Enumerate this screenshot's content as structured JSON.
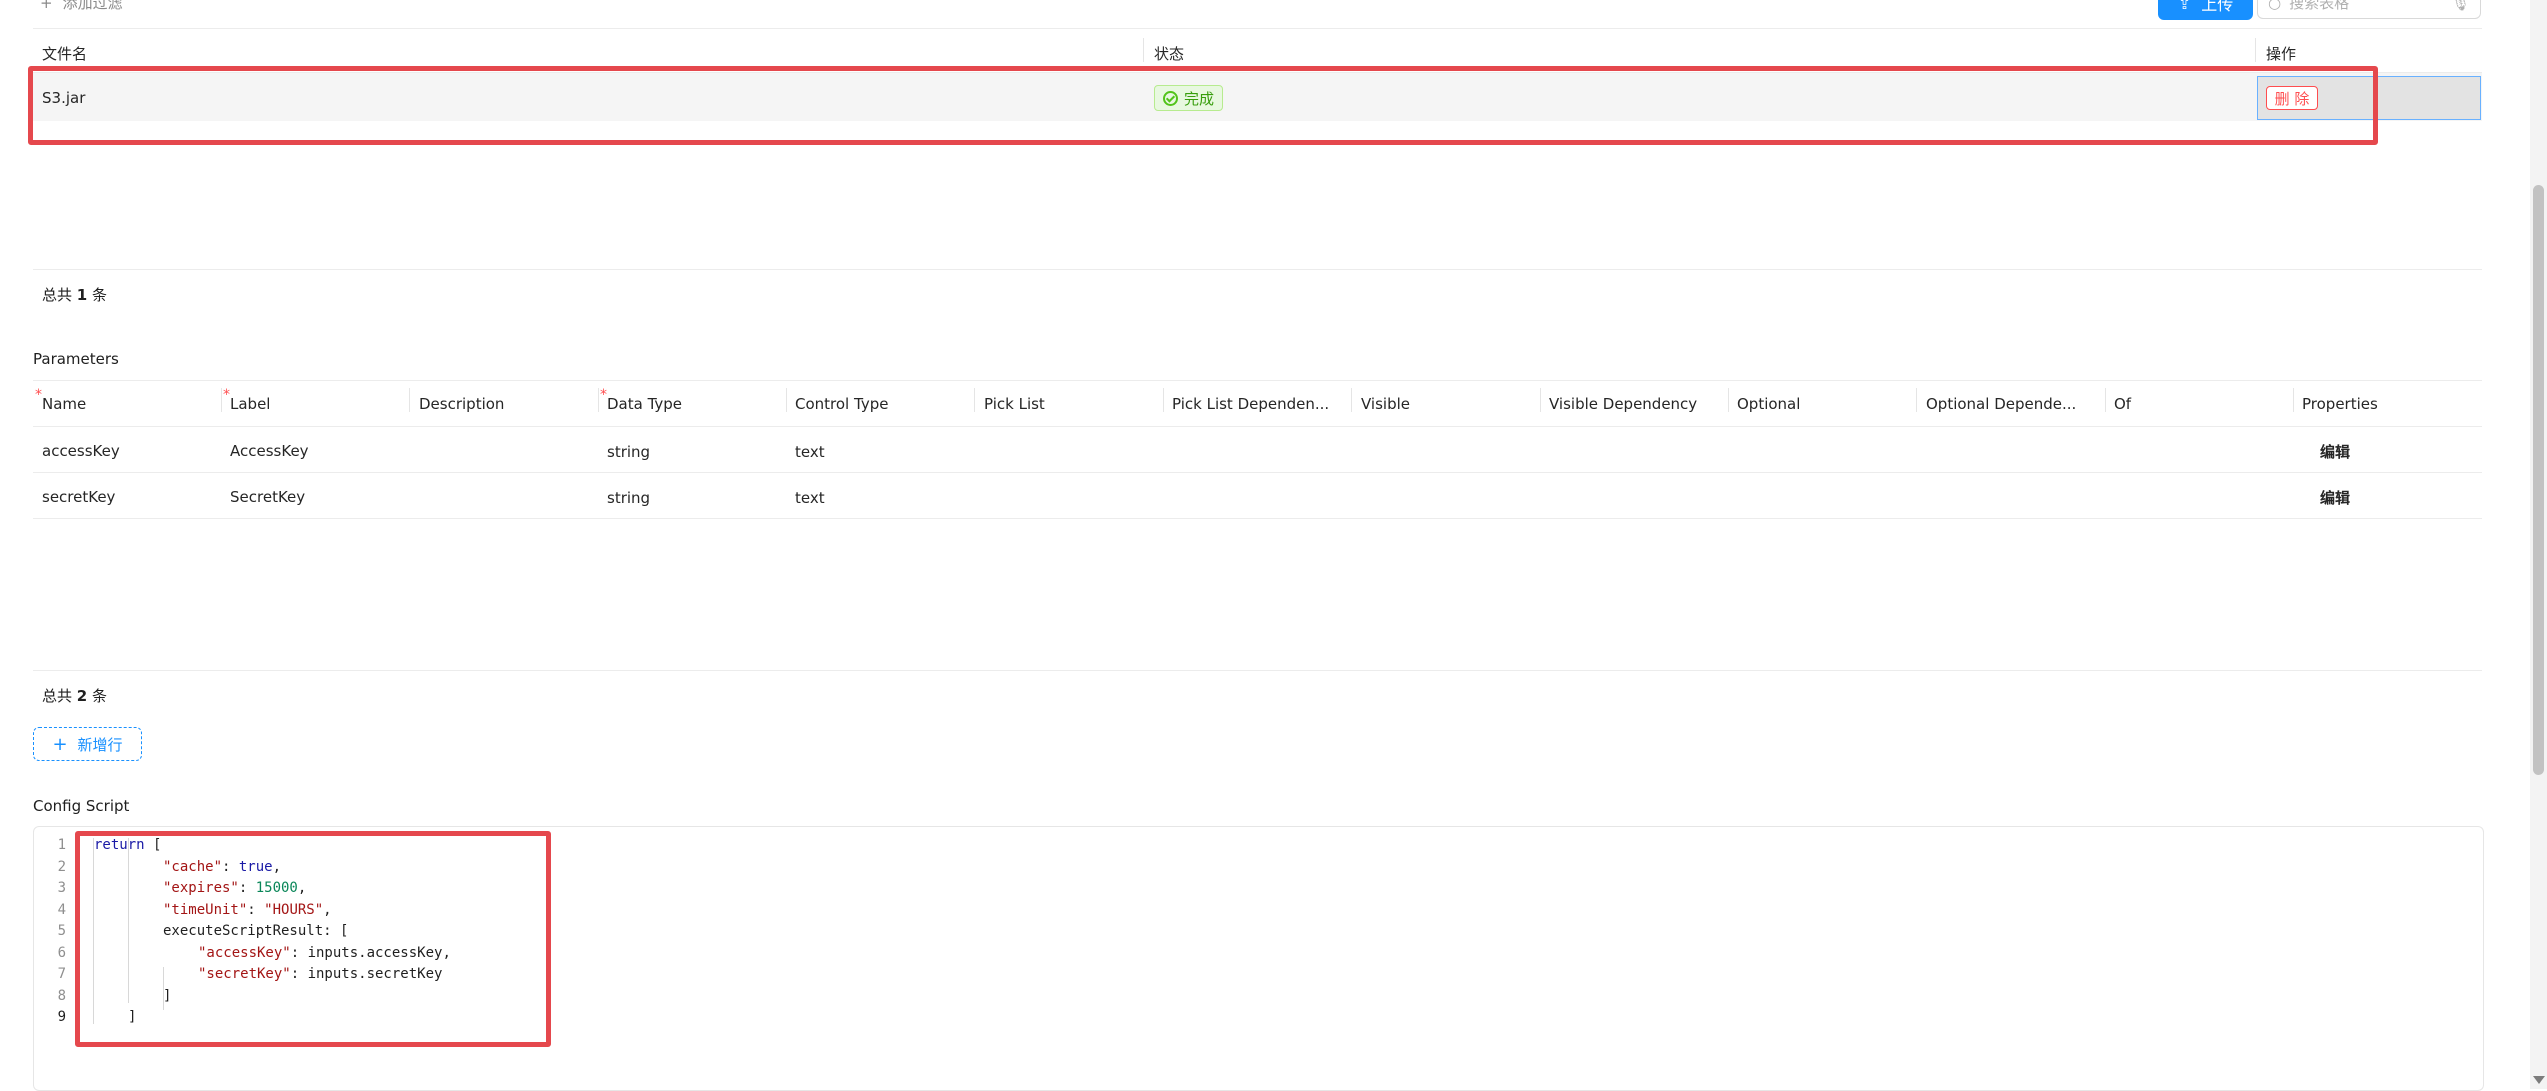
{
  "toolbar": {
    "add_filter": "添加过滤",
    "upload_label": "上传",
    "search_placeholder": "搜索表格"
  },
  "files_table": {
    "headers": {
      "name": "文件名",
      "status": "状态",
      "actions": "操作"
    },
    "rows": [
      {
        "name": "S3.jar",
        "status": "完成",
        "delete": "删 除"
      }
    ],
    "total_prefix": "总共",
    "total_count": "1",
    "total_suffix": "条"
  },
  "parameters": {
    "title": "Parameters",
    "headers": [
      "Name",
      "Label",
      "Description",
      "Data Type",
      "Control Type",
      "Pick List",
      "Pick List Dependen...",
      "Visible",
      "Visible Dependency",
      "Optional",
      "Optional Depende...",
      "Of",
      "Properties"
    ],
    "rows": [
      {
        "name": "accessKey",
        "label": "AccessKey",
        "description": "",
        "data_type": "string",
        "control_type": "text",
        "edit": "编辑"
      },
      {
        "name": "secretKey",
        "label": "SecretKey",
        "description": "",
        "data_type": "string",
        "control_type": "text",
        "edit": "编辑"
      }
    ],
    "total_prefix": "总共",
    "total_count": "2",
    "total_suffix": "条",
    "add_row": "新增行"
  },
  "config_script": {
    "title": "Config Script",
    "line_numbers": [
      "1",
      "2",
      "3",
      "4",
      "5",
      "6",
      "7",
      "8",
      "9"
    ],
    "lines": {
      "l1_kw": "return",
      "l1_rest": " [",
      "l2_key": "\"cache\"",
      "l2_val": "true",
      "l3_key": "\"expires\"",
      "l3_val": "15000",
      "l4_key": "\"timeUnit\"",
      "l4_val": "\"HOURS\"",
      "l5": "executeScriptResult: [",
      "l6_key": "\"accessKey\"",
      "l6_val": "inputs.accessKey,",
      "l7_key": "\"secretKey\"",
      "l7_val": "inputs.secretKey",
      "l8": "]",
      "l9": "]"
    }
  },
  "colors": {
    "accent": "#1890ff",
    "success": "#52c41a",
    "danger": "#ff4d4f",
    "highlight": "#e5484d"
  }
}
